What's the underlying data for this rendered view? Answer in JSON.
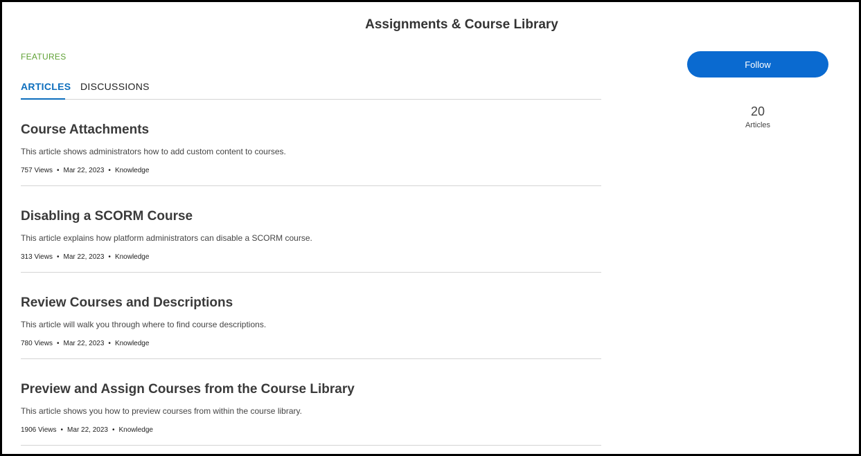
{
  "header": {
    "title": "Assignments & Course Library"
  },
  "category": "FEATURES",
  "tabs": [
    {
      "label": "ARTICLES",
      "active": true
    },
    {
      "label": "DISCUSSIONS",
      "active": false
    }
  ],
  "sidebar": {
    "follow_label": "Follow",
    "count": "20",
    "count_label": "Articles"
  },
  "articles": [
    {
      "title": "Course Attachments",
      "summary": "This article shows administrators how to add custom content to courses.",
      "views": "757 Views",
      "date": "Mar 22, 2023",
      "type": "Knowledge"
    },
    {
      "title": "Disabling a SCORM Course",
      "summary": "This article explains how platform administrators can disable a SCORM course.",
      "views": "313 Views",
      "date": "Mar 22, 2023",
      "type": "Knowledge"
    },
    {
      "title": "Review Courses and Descriptions",
      "summary": "This article will walk you through where to find course descriptions.",
      "views": "780 Views",
      "date": "Mar 22, 2023",
      "type": "Knowledge"
    },
    {
      "title": "Preview and Assign Courses from the Course Library",
      "summary": "This article shows you how to preview courses from within the course library.",
      "views": "1906 Views",
      "date": "Mar 22, 2023",
      "type": "Knowledge"
    }
  ],
  "colors": {
    "accent": "#0c6ebd",
    "button": "#0a6ad0",
    "category": "#5fa135"
  }
}
